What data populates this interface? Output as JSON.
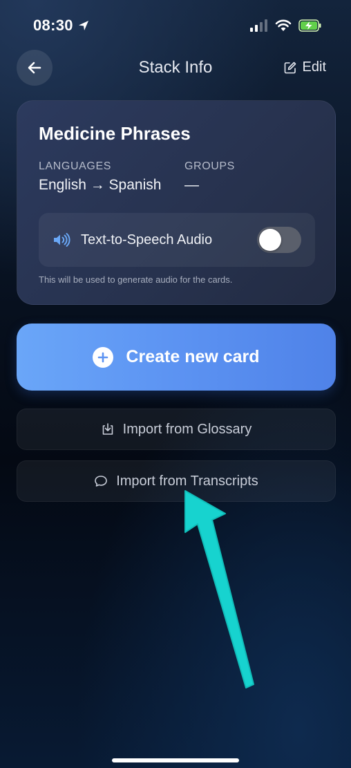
{
  "status_bar": {
    "time": "08:30",
    "icons": [
      "location-arrow-icon",
      "signal-icon",
      "wifi-icon",
      "battery-charging-icon"
    ]
  },
  "nav": {
    "title": "Stack Info",
    "edit_label": "Edit",
    "back_icon": "arrow-left-icon",
    "edit_icon": "edit-square-icon"
  },
  "stack": {
    "title": "Medicine Phrases",
    "languages_label": "LANGUAGES",
    "languages_value": "English → Spanish",
    "groups_label": "GROUPS",
    "groups_value": "—"
  },
  "tts": {
    "label": "Text-to-Speech Audio",
    "enabled": false,
    "help_text": "This will be used to generate audio for the cards.",
    "icon": "speaker-icon"
  },
  "actions": {
    "create_label": "Create new card",
    "import_glossary_label": "Import from Glossary",
    "import_transcripts_label": "Import from Transcripts"
  },
  "colors": {
    "accent": "#5c93f2",
    "annotation_arrow": "#17d3cf"
  }
}
